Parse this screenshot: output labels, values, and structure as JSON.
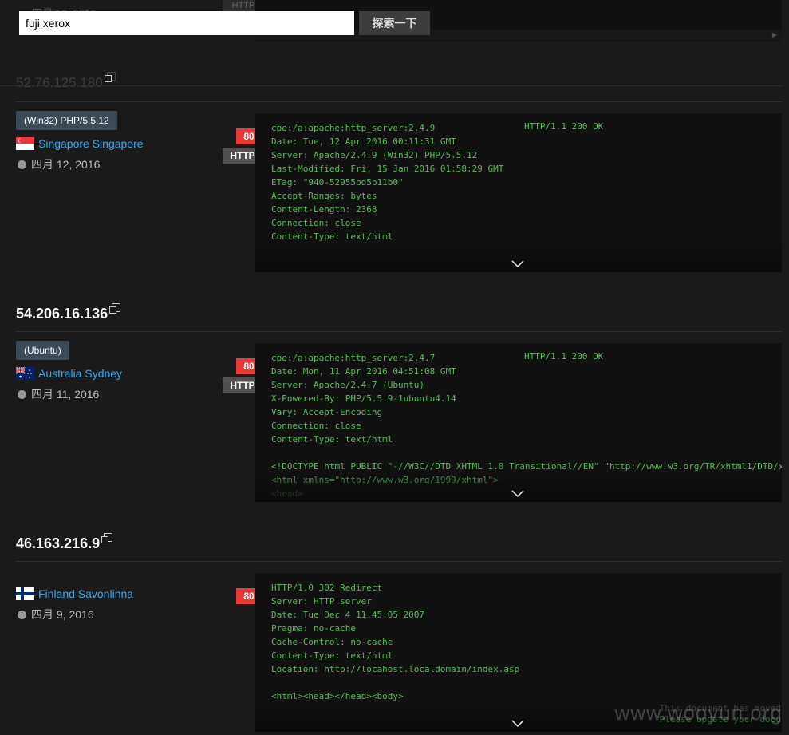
{
  "search": {
    "query": "fuji xerox",
    "button_label": "探索一下"
  },
  "ghost": {
    "date": "四月 12, 2016",
    "proto": "HTTP",
    "ip": "52.76.125.180"
  },
  "results": [
    {
      "ip": "",
      "server_tag": "(Win32) PHP/5.5.12",
      "location": "Singapore Singapore",
      "date": "四月 12, 2016",
      "port": "80",
      "proto": "HTTP",
      "status": "HTTP/1.1 200 OK",
      "banner": "cpe:/a:apache:http_server:2.4.9\nDate: Tue, 12 Apr 2016 00:11:31 GMT\nServer: Apache/2.4.9 (Win32) PHP/5.5.12\nLast-Modified: Fri, 15 Jan 2016 01:58:29 GMT\nETag: \"940-52955bd5b11b0\"\nAccept-Ranges: bytes\nContent-Length: 2368\nConnection: close\nContent-Type: text/html"
    },
    {
      "ip": "54.206.16.136",
      "server_tag": "(Ubuntu)",
      "location": "Australia Sydney",
      "date": "四月 11, 2016",
      "port": "80",
      "proto": "HTTP",
      "status": "HTTP/1.1 200 OK",
      "banner": "cpe:/a:apache:http_server:2.4.7\nDate: Mon, 11 Apr 2016 04:51:08 GMT\nServer: Apache/2.4.7 (Ubuntu)\nX-Powered-By: PHP/5.5.9-1ubuntu4.14\nVary: Accept-Encoding\nConnection: close\nContent-Type: text/html\n\n<!DOCTYPE html PUBLIC \"-//W3C//DTD XHTML 1.0 Transitional//EN\" \"http://www.w3.org/TR/xhtml1/DTD/x\n<html xmlns=\"http://www.w3.org/1999/xhtml\">\n<head>"
    },
    {
      "ip": "46.163.216.9",
      "location": "Finland Savonlinna",
      "date": "四月 9, 2016",
      "port": "80",
      "banner": "HTTP/1.0 302 Redirect\nServer: HTTP server\nDate: Tue Dec 4 11:45:05 2007\nPragma: no-cache\nCache-Control: no-cache\nContent-Type: text/html\nLocation: http://locahost.localdomain/index.asp\n\n<html><head></head><body>",
      "overlay_1": "This document has moved",
      "overlay_2": "Please update your docu"
    }
  ],
  "watermark": "www.wooyun.org",
  "colors": {
    "background": "#1a1a1a",
    "banner_bg": "#111111",
    "banner_text": "#5cb85c",
    "link": "#3ba8e8",
    "port_badge": "#e53935",
    "proto_badge": "#505050",
    "tag_bg": "#3c4a57"
  }
}
